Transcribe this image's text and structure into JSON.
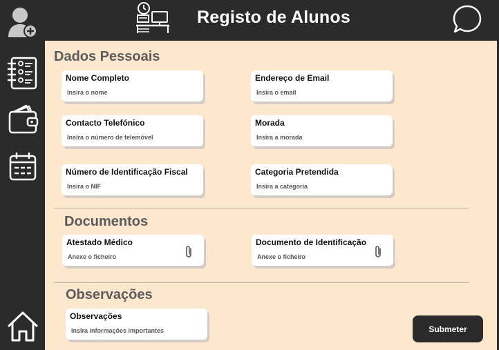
{
  "header": {
    "title": "Registo de Alunos",
    "logo_icon": "desk-clock-icon",
    "chat_icon": "chat-bubble-icon"
  },
  "sidebar": {
    "items": [
      {
        "icon": "add-user-icon"
      },
      {
        "icon": "student-list-icon"
      },
      {
        "icon": "wallet-icon"
      },
      {
        "icon": "calendar-icon"
      },
      {
        "icon": "home-icon"
      }
    ]
  },
  "sections": {
    "personal": {
      "title": "Dados Pessoais",
      "fields": [
        {
          "label": "Nome Completo",
          "placeholder": "Insira o nome"
        },
        {
          "label": "Endereço de Email",
          "placeholder": "Insira o email"
        },
        {
          "label": "Contacto Telefónico",
          "placeholder": "Insira o número de telemóvel"
        },
        {
          "label": "Morada",
          "placeholder": "Insira a morada"
        },
        {
          "label": "Número de Identificação Fiscal",
          "placeholder": "Insira o NIF"
        },
        {
          "label": "Categoria Pretendida",
          "placeholder": "Insira a categoria"
        }
      ]
    },
    "documents": {
      "title": "Documentos",
      "fields": [
        {
          "label": "Atestado Médico",
          "placeholder": "Anexe o ficheiro",
          "icon": "paperclip-icon"
        },
        {
          "label": "Documento de Identificação",
          "placeholder": "Anexe o ficheiro",
          "icon": "paperclip-icon"
        }
      ]
    },
    "notes": {
      "title": "Observações",
      "fields": [
        {
          "label": "Observações",
          "placeholder": "Insira informações importantes"
        }
      ]
    }
  },
  "actions": {
    "submit_label": "Submeter"
  },
  "colors": {
    "dark": "#2b2b2b",
    "background": "#fde7cd",
    "card": "#ffffff",
    "section_title": "#5c5c5c"
  }
}
